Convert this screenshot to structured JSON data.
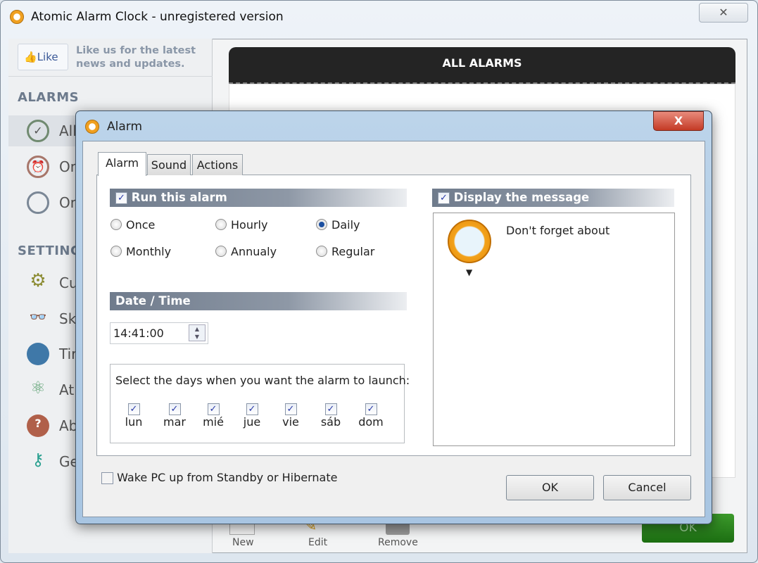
{
  "window": {
    "title": "Atomic Alarm Clock - unregistered version",
    "close": "✕"
  },
  "sidebar": {
    "like_button": "Like",
    "like_text_1": "Like us for the latest",
    "like_text_2": "news and updates.",
    "alarms_header": "ALARMS",
    "alarm_items": [
      {
        "label": "All",
        "icon": "clock-check-icon"
      },
      {
        "label": "On",
        "icon": "alarm-clock-icon"
      },
      {
        "label": "On",
        "icon": "clock-icon"
      }
    ],
    "settings_header": "SETTINGS",
    "settings_items": [
      {
        "label": "Cu",
        "icon": "gear-icon"
      },
      {
        "label": "Sk",
        "icon": "glasses-icon"
      },
      {
        "label": "Tir",
        "icon": "globe-icon"
      },
      {
        "label": "At",
        "icon": "atom-icon"
      },
      {
        "label": "Ab",
        "icon": "help-icon"
      },
      {
        "label": "Ge",
        "icon": "key-icon"
      }
    ]
  },
  "main": {
    "header": "ALL ALARMS",
    "toolbar": {
      "new": "New",
      "edit": "Edit",
      "remove": "Remove"
    },
    "ok": "OK"
  },
  "dialog": {
    "title": "Alarm",
    "close": "X",
    "tabs": [
      "Alarm",
      "Sound",
      "Actions"
    ],
    "run_this_alarm": {
      "label": "Run this alarm",
      "checked": true
    },
    "recurrence": [
      {
        "label": "Once",
        "selected": false
      },
      {
        "label": "Hourly",
        "selected": false
      },
      {
        "label": "Daily",
        "selected": true
      },
      {
        "label": "Monthly",
        "selected": false
      },
      {
        "label": "Annualy",
        "selected": false
      },
      {
        "label": "Regular",
        "selected": false
      }
    ],
    "date_time_header": "Date / Time",
    "time": "14:41:00",
    "days_label": "Select the days when you want the alarm to launch:",
    "days": [
      {
        "label": "lun",
        "checked": true
      },
      {
        "label": "mar",
        "checked": true
      },
      {
        "label": "mié",
        "checked": true
      },
      {
        "label": "jue",
        "checked": true
      },
      {
        "label": "vie",
        "checked": true
      },
      {
        "label": "sáb",
        "checked": true
      },
      {
        "label": "dom",
        "checked": true
      }
    ],
    "display_message": {
      "label": "Display the message",
      "checked": true
    },
    "message": "Don't forget about",
    "wake": {
      "label": "Wake PC up from Standby or Hibernate",
      "checked": false
    },
    "ok": "OK",
    "cancel": "Cancel"
  },
  "check_glyph": "✓"
}
